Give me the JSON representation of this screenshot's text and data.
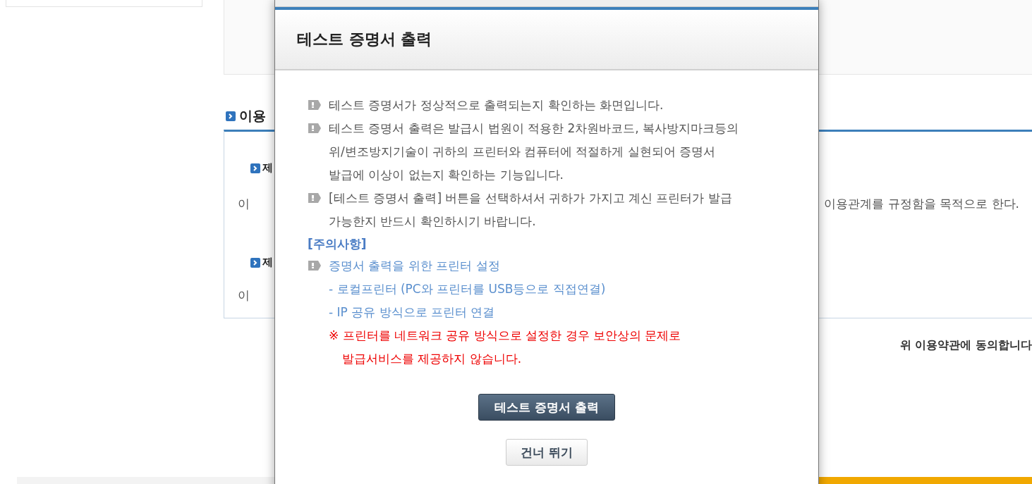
{
  "page": {
    "section_title": "이용",
    "terms": [
      {
        "heading": "제",
        "text": "이"
      },
      {
        "heading": "제",
        "text": "이"
      }
    ],
    "term_text_right": "이용관계를 규정함을 목적으로 한다.",
    "agree_label": "위 이용약관에 동의합니다"
  },
  "dialog": {
    "title": "테스트 증명서 출력",
    "items": [
      {
        "kind": "note",
        "lines": [
          "테스트 증명서가 정상적으로 출력되는지 확인하는 화면입니다."
        ]
      },
      {
        "kind": "note",
        "lines": [
          "테스트 증명서 출력은 발급시 법원이 적용한 2차원바코드, 복사방지마크등의",
          "위/변조방지기술이 귀하의 프린터와 컴퓨터에 적절하게 실현되어 증명서",
          "발급에 이상이 없는지 확인하는 기능입니다."
        ]
      },
      {
        "kind": "note",
        "lines": [
          "[테스트 증명서 출력] 버튼을 선택하셔서 귀하가 가지고 계신 프린터가 발급",
          "가능한지 반드시 확인하시기 바랍니다."
        ]
      },
      {
        "kind": "caution-heading",
        "lines": [
          "[주의사항]"
        ]
      },
      {
        "kind": "caution-bullet",
        "lines": [
          "증명서 출력을 위한 프린터 설정"
        ]
      },
      {
        "kind": "caution-sub",
        "lines": [
          "- 로컬프린터 (PC와 프린터를 USB등으로 직접연결)"
        ]
      },
      {
        "kind": "caution-sub",
        "lines": [
          "- IP 공유 방식으로 프린터 연결"
        ]
      },
      {
        "kind": "warning",
        "lines": [
          "※ 프린터를 네트워크 공유 방식으로 설정한 경우 보안상의 문제로",
          "발급서비스를 제공하지 않습니다."
        ]
      }
    ],
    "buttons": [
      {
        "label": "테스트 증명서 출력",
        "kind": "primary"
      },
      {
        "label": "건너 뛰기",
        "kind": "secondary"
      }
    ]
  }
}
